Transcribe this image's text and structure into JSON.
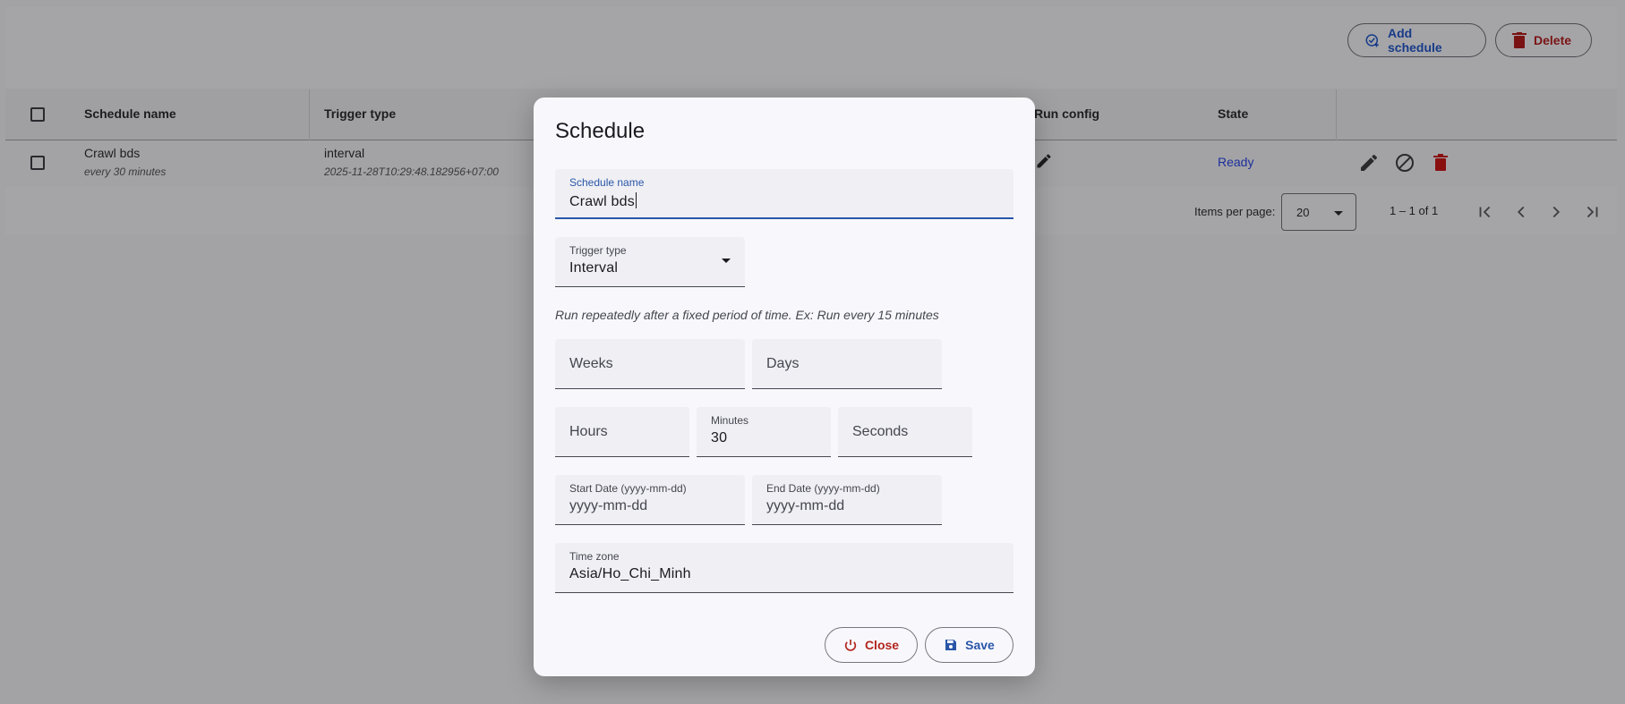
{
  "toolbar": {
    "add_schedule_label": "Add schedule",
    "delete_label": "Delete"
  },
  "table": {
    "columns": [
      "Schedule name",
      "Trigger type",
      "Run config",
      "State"
    ],
    "rows": [
      {
        "name": "Crawl bds",
        "description": "every 30 minutes",
        "trigger_type": "interval",
        "trigger_detail": "2025-11-28T10:29:48.182956+07:00",
        "state": "Ready"
      }
    ]
  },
  "pagination": {
    "items_per_page_label": "Items per page:",
    "items_per_page_value": "20",
    "range_label": "1 – 1 of 1"
  },
  "dialog": {
    "title": "Schedule",
    "schedule_name": {
      "label": "Schedule name",
      "value": "Crawl bds"
    },
    "trigger_type": {
      "label": "Trigger type",
      "value": "Interval"
    },
    "help_text": "Run repeatedly after a fixed period of time. Ex: Run every 15 minutes",
    "weeks": {
      "placeholder": "Weeks"
    },
    "days": {
      "placeholder": "Days"
    },
    "hours": {
      "placeholder": "Hours"
    },
    "minutes": {
      "label": "Minutes",
      "value": "30"
    },
    "seconds": {
      "placeholder": "Seconds"
    },
    "start_date": {
      "label": "Start Date (yyyy-mm-dd)",
      "placeholder": "yyyy-mm-dd"
    },
    "end_date": {
      "label": "End Date (yyyy-mm-dd)",
      "placeholder": "yyyy-mm-dd"
    },
    "time_zone": {
      "label": "Time zone",
      "value": "Asia/Ho_Chi_Minh"
    },
    "close_label": "Close",
    "save_label": "Save"
  },
  "colors": {
    "accent": "#2a56a8",
    "danger": "#b3261e",
    "state_ready": "#1c2f9a"
  }
}
